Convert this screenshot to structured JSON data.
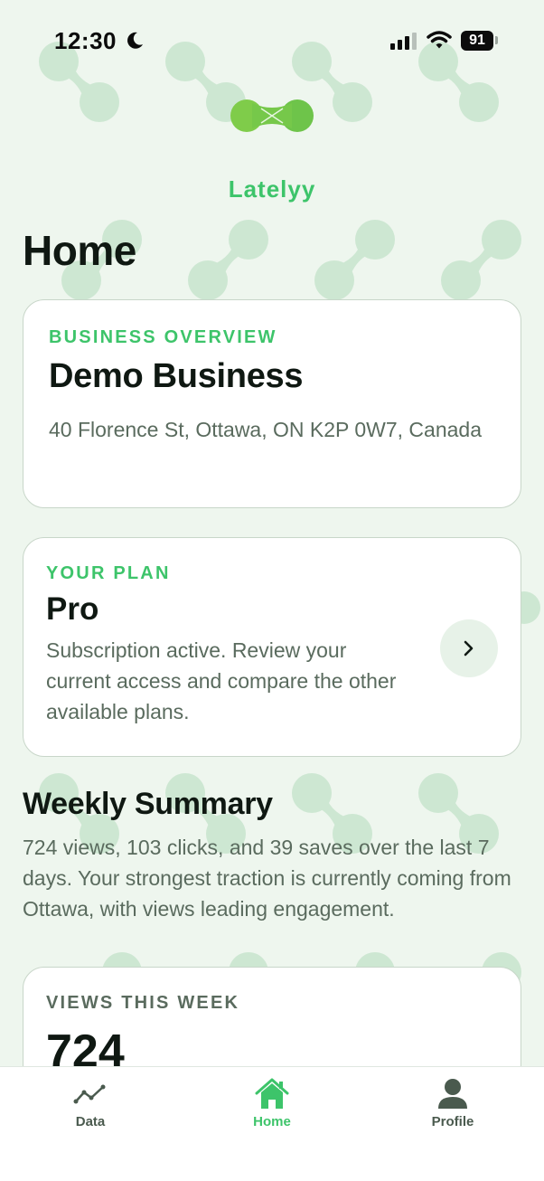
{
  "status_bar": {
    "time": "12:30",
    "battery": "91"
  },
  "brand": {
    "name": "Latelyy"
  },
  "page": {
    "title": "Home"
  },
  "business_overview": {
    "eyebrow": "BUSINESS OVERVIEW",
    "name": "Demo Business",
    "address": "40 Florence St, Ottawa, ON K2P 0W7, Canada"
  },
  "plan": {
    "eyebrow": "YOUR PLAN",
    "name": "Pro",
    "description": "Subscription active. Review your current access and compare the other available plans."
  },
  "weekly_summary": {
    "title": "Weekly Summary",
    "text": "724 views, 103 clicks, and 39 saves over the last 7 days. Your strongest traction is currently coming from Ottawa, with views leading engagement."
  },
  "views_card": {
    "eyebrow": "VIEWS THIS WEEK",
    "value": "724"
  },
  "tab_bar": {
    "tabs": [
      {
        "label": "Data",
        "icon": "chart-line-icon",
        "active": false
      },
      {
        "label": "Home",
        "icon": "home-icon",
        "active": true
      },
      {
        "label": "Profile",
        "icon": "person-icon",
        "active": false
      }
    ]
  },
  "colors": {
    "accent": "#3dc46a",
    "background": "#eef6ee",
    "muted_text": "#5a6b5e"
  }
}
